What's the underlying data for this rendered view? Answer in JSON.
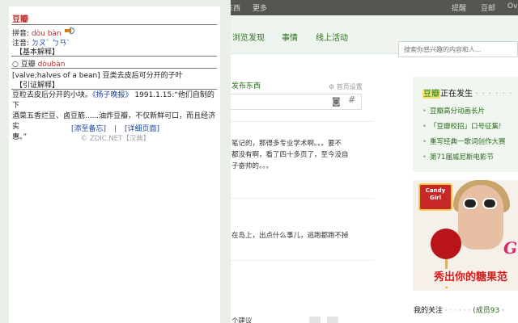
{
  "douban": {
    "topbar": {
      "left_partial": "买东西",
      "more": "更多",
      "right_items": [
        "提醒",
        "豆邮",
        "Ov"
      ]
    },
    "nav": {
      "items": [
        "浏览发现",
        "事情",
        "线上活动"
      ],
      "search_placeholder": "搜索你感兴趣的内容和人..."
    },
    "post": {
      "label": "发布东西",
      "settings": "首页设置"
    },
    "feed": [
      "笔记的，那得多专业学术啊。。。要不",
      "都没有啊，看了四十多页了，至今没自",
      "子奋帅的。。。",
      "在岛上，出点什么事儿，逃跑都跑不掉"
    ],
    "suggest_partial": "个建议",
    "happening": {
      "brand": "豆瓣",
      "title_rest": "正在发生",
      "dots": "· · · · · ·",
      "items": [
        "豆瓣高分动画长片",
        "「豆瓣校招」口号征集!",
        "重写经典一歌词创作大赛",
        "第71届威尼斯电影节"
      ]
    },
    "ad": {
      "box_line1": "Candy",
      "box_line2": "Girl",
      "slogan": "秀出你的糖果范",
      "glyph": "G"
    },
    "follow": {
      "title": "我的关注",
      "dots": "· · · · · ·",
      "count": "(成员93 ·"
    }
  },
  "dict": {
    "word": "豆瓣",
    "pinyin_label": "拼音:",
    "pinyin": "dòu bàn",
    "zhuyin_label": "注音:",
    "zhuyin": "ㄉㄡˋ ㄅㄢˋ",
    "basic_header": "【基本解释】",
    "basic_entry_word": "豆瓣",
    "basic_entry_pinyin": "dòubàn",
    "basic_def_en": "[valve;halves of a bean]",
    "basic_def_cn": "豆类去皮后可分开的子叶",
    "cite_header": "【引证解释】",
    "cite_line1_a": "豆粒去皮后分开的小块。",
    "cite_line1_src": "《扬子晚报》",
    "cite_line1_b": "1991.1.15:“他们自制的下",
    "cite_line2": "酒菜五香烂豆、卤豆筋......油炸豆瓣，不仅新鲜可口，而且经济实",
    "cite_line3": "惠。”",
    "link_add": "[添至备忘]",
    "link_sep": "|",
    "link_detail": "[详细页面]",
    "copyright": "© ZDIC.NET【汉典】"
  }
}
